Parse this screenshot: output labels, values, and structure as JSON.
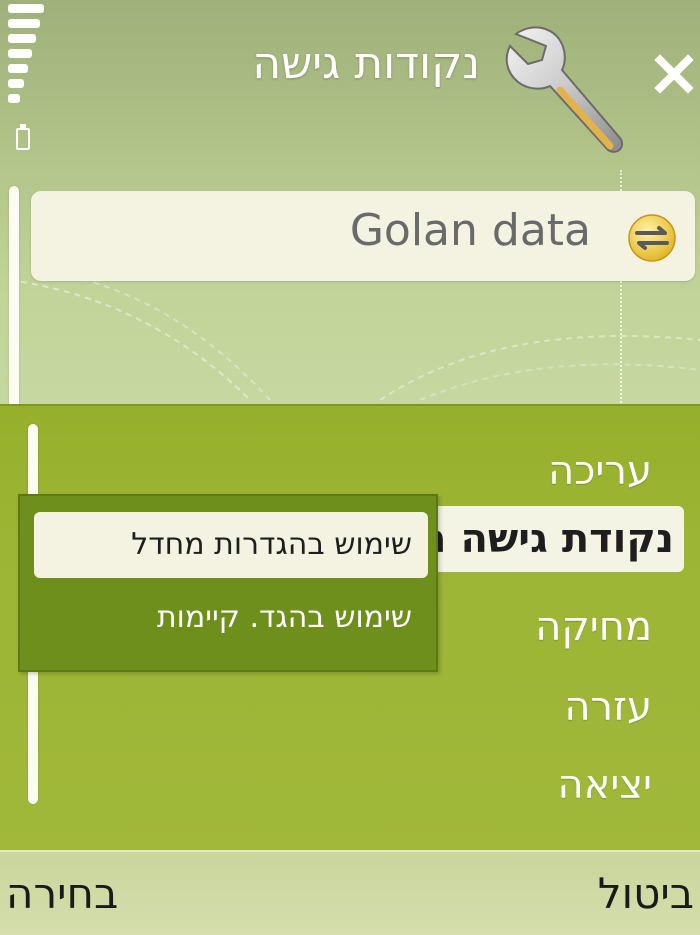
{
  "header": {
    "title": "נקודות גישה",
    "app_icon": "wrench-icon",
    "close_icon": "close-icon"
  },
  "status": {
    "signal_icon": "signal-strength-icon",
    "signal_bars": 7,
    "battery_icon": "battery-icon"
  },
  "list": {
    "items": [
      {
        "label": "Golan data",
        "icon": "access-point-icon"
      }
    ]
  },
  "options_menu": {
    "items": [
      {
        "label": "עריכה"
      },
      {
        "label": "נקודת גישה חדשה",
        "selected": true
      },
      {
        "label": "מחיקה"
      },
      {
        "label": "עזרה"
      },
      {
        "label": "יציאה"
      }
    ]
  },
  "submenu": {
    "items": [
      {
        "label": "שימוש בהגדרות מחדל",
        "selected": true
      },
      {
        "label": "שימוש בהגד. קיימות"
      }
    ]
  },
  "softkeys": {
    "left": "בחירה",
    "right": "ביטול"
  },
  "colors": {
    "menu_green": "#9cb534",
    "submenu_green": "#6e8f1c",
    "highlight": "#f4f3e2"
  }
}
